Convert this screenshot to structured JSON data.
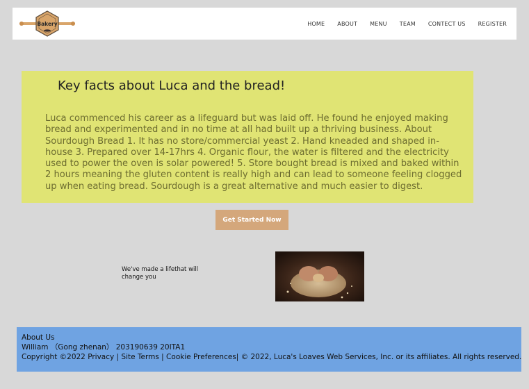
{
  "header": {
    "logo_text": "Bakery",
    "nav": [
      "HOME",
      "ABOUT",
      "MENU",
      "TEAM",
      "CONTECT US",
      "REGISTER"
    ]
  },
  "facts": {
    "title": "Key facts about Luca and the bread!",
    "body": "Luca commenced his career as a lifeguard but was laid off. He found he enjoyed making bread and experimented and in no time at all had built up a thriving business. About Sourdough Bread 1. It has no store/commercial yeast 2. Hand kneaded and shaped in-house 3. Prepared over 14-17hrs 4. Organic flour, the water is filtered and the electricity used to power the oven is solar powered! 5. Store bought bread is mixed and baked within 2 hours meaning the gluten content is really high and can lead to someone feeling clogged up when eating bread. Sourdough is a great alternative and much easier to digest."
  },
  "cta_label": "Get Started Now",
  "tagline": "We've made a lifethat will change you",
  "footer": {
    "about": "About Us",
    "author": "William （Gong zhenan） 203190639 20ITA1",
    "copyright": "Copyright ©2022 Privacy | Site Terms | Cookie Preferences| © 2022, Luca's Loaves Web Services, Inc. or its affiliates. All rights reserved."
  },
  "colors": {
    "background": "#d8d8d8",
    "card": "#e0e474",
    "button": "#d4a77b",
    "footer": "#6fa3e2"
  }
}
